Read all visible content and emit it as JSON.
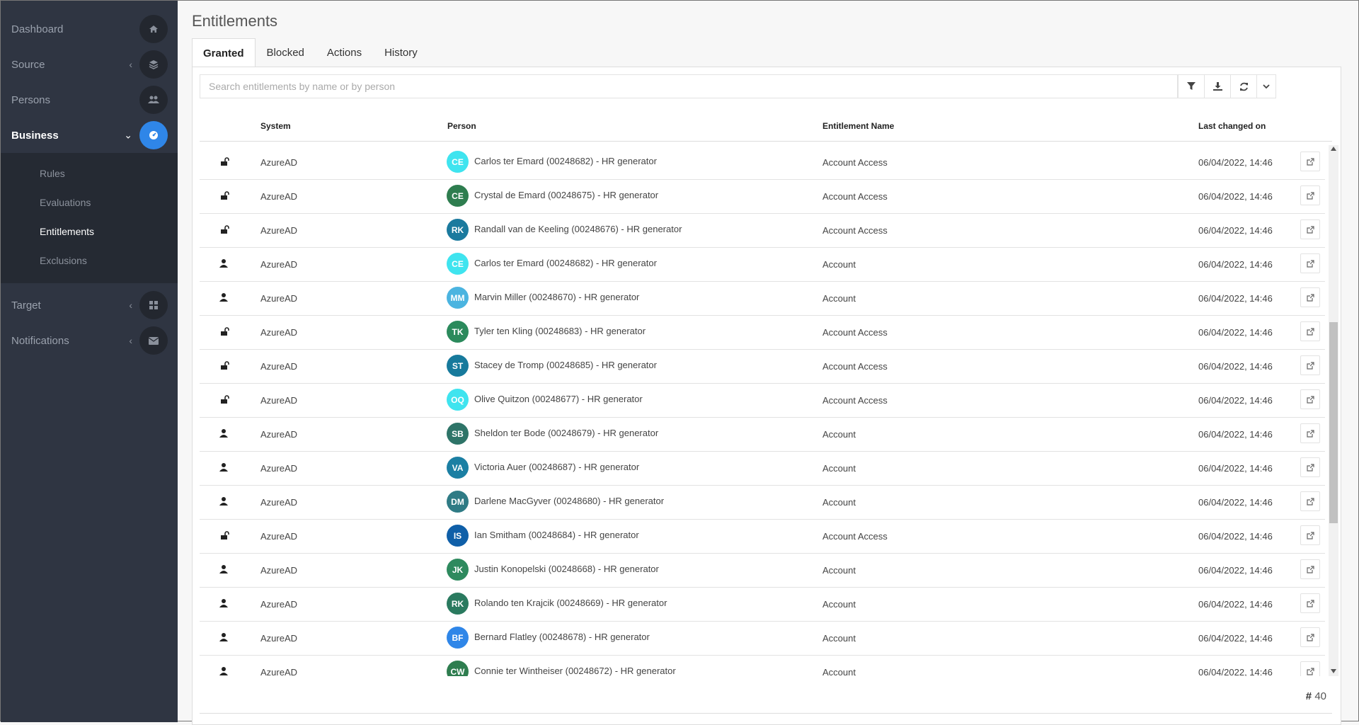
{
  "sidebar": {
    "items": [
      {
        "label": "Dashboard",
        "icon": "home-icon",
        "chevron": ""
      },
      {
        "label": "Source",
        "icon": "layers-icon",
        "chevron": "‹"
      },
      {
        "label": "Persons",
        "icon": "users-icon",
        "chevron": ""
      },
      {
        "label": "Business",
        "icon": "dashboard-icon",
        "chevron": "⌄"
      }
    ],
    "submenu": [
      "Rules",
      "Evaluations",
      "Entitlements",
      "Exclusions"
    ],
    "items_after": [
      {
        "label": "Target",
        "icon": "grid-icon",
        "chevron": "‹"
      },
      {
        "label": "Notifications",
        "icon": "envelope-icon",
        "chevron": "‹"
      }
    ]
  },
  "page": {
    "title": "Entitlements"
  },
  "tabs": [
    "Granted",
    "Blocked",
    "Actions",
    "History"
  ],
  "search": {
    "placeholder": "Search entitlements by name or by person"
  },
  "table": {
    "headers": {
      "system": "System",
      "person": "Person",
      "entitlement": "Entitlement Name",
      "changed": "Last changed on"
    },
    "rows": [
      {
        "icon": "unlock-icon",
        "system": "AzureAD",
        "initials": "CE",
        "color": "#3fe4ef",
        "person": "Carlos ter Emard (00248682) - HR generator",
        "entitlement": "Account Access",
        "date": "06/04/2022, 14:46"
      },
      {
        "icon": "unlock-icon",
        "system": "AzureAD",
        "initials": "CE",
        "color": "#2e7d4f",
        "person": "Crystal de Emard (00248675) - HR generator",
        "entitlement": "Account Access",
        "date": "06/04/2022, 14:46"
      },
      {
        "icon": "unlock-icon",
        "system": "AzureAD",
        "initials": "RK",
        "color": "#1b7a9e",
        "person": "Randall van de Keeling (00248676) - HR generator",
        "entitlement": "Account Access",
        "date": "06/04/2022, 14:46"
      },
      {
        "icon": "user-icon",
        "system": "AzureAD",
        "initials": "CE",
        "color": "#3fe4ef",
        "person": "Carlos ter Emard (00248682) - HR generator",
        "entitlement": "Account",
        "date": "06/04/2022, 14:46"
      },
      {
        "icon": "user-icon",
        "system": "AzureAD",
        "initials": "MM",
        "color": "#4bb4e0",
        "person": "Marvin Miller (00248670) - HR generator",
        "entitlement": "Account",
        "date": "06/04/2022, 14:46"
      },
      {
        "icon": "unlock-icon",
        "system": "AzureAD",
        "initials": "TK",
        "color": "#2b8a5c",
        "person": "Tyler ten Kling (00248683) - HR generator",
        "entitlement": "Account Access",
        "date": "06/04/2022, 14:46"
      },
      {
        "icon": "unlock-icon",
        "system": "AzureAD",
        "initials": "ST",
        "color": "#177a9c",
        "person": "Stacey de Tromp (00248685) - HR generator",
        "entitlement": "Account Access",
        "date": "06/04/2022, 14:46"
      },
      {
        "icon": "unlock-icon",
        "system": "AzureAD",
        "initials": "OQ",
        "color": "#3fe4ef",
        "person": "Olive Quitzon (00248677) - HR generator",
        "entitlement": "Account Access",
        "date": "06/04/2022, 14:46"
      },
      {
        "icon": "user-icon",
        "system": "AzureAD",
        "initials": "SB",
        "color": "#2e7468",
        "person": "Sheldon ter Bode (00248679) - HR generator",
        "entitlement": "Account",
        "date": "06/04/2022, 14:46"
      },
      {
        "icon": "user-icon",
        "system": "AzureAD",
        "initials": "VA",
        "color": "#1b7fa3",
        "person": "Victoria Auer (00248687) - HR generator",
        "entitlement": "Account",
        "date": "06/04/2022, 14:46"
      },
      {
        "icon": "user-icon",
        "system": "AzureAD",
        "initials": "DM",
        "color": "#2f7b85",
        "person": "Darlene MacGyver (00248680) - HR generator",
        "entitlement": "Account",
        "date": "06/04/2022, 14:46"
      },
      {
        "icon": "unlock-icon",
        "system": "AzureAD",
        "initials": "IS",
        "color": "#0f5fa8",
        "person": "Ian Smitham (00248684) - HR generator",
        "entitlement": "Account Access",
        "date": "06/04/2022, 14:46"
      },
      {
        "icon": "user-icon",
        "system": "AzureAD",
        "initials": "JK",
        "color": "#2e8a5e",
        "person": "Justin Konopelski (00248668) - HR generator",
        "entitlement": "Account",
        "date": "06/04/2022, 14:46"
      },
      {
        "icon": "user-icon",
        "system": "AzureAD",
        "initials": "RK",
        "color": "#2a7a5f",
        "person": "Rolando ten Krajcik (00248669) - HR generator",
        "entitlement": "Account",
        "date": "06/04/2022, 14:46"
      },
      {
        "icon": "user-icon",
        "system": "AzureAD",
        "initials": "BF",
        "color": "#2f86e8",
        "person": "Bernard Flatley (00248678) - HR generator",
        "entitlement": "Account",
        "date": "06/04/2022, 14:46"
      },
      {
        "icon": "user-icon",
        "system": "AzureAD",
        "initials": "CW",
        "color": "#2e7d4f",
        "person": "Connie ter Wintheiser (00248672) - HR generator",
        "entitlement": "Account",
        "date": "06/04/2022, 14:46"
      }
    ]
  },
  "footer": {
    "count_symbol": "#",
    "count": "40"
  }
}
